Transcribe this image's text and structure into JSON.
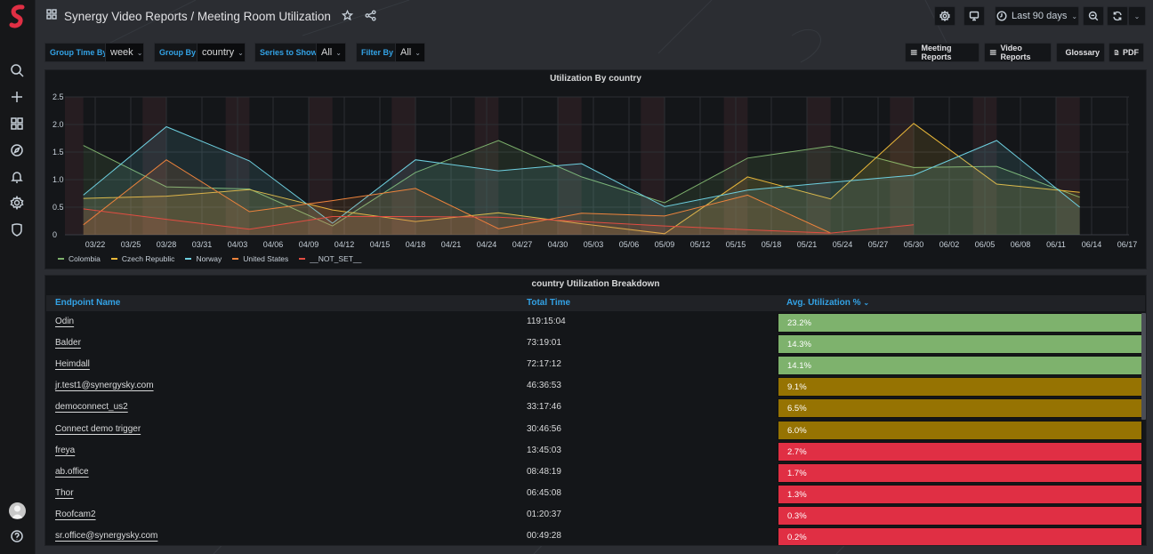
{
  "app": {
    "breadcrumb": "Synergy Video Reports / Meeting Room Utilization"
  },
  "header": {
    "time_range": "Last 90 days",
    "icons": [
      "settings-icon",
      "tv-mode-icon",
      "clock-icon",
      "zoom-out-icon",
      "refresh-icon",
      "chevron-down-icon"
    ]
  },
  "sidebar": {
    "items": [
      {
        "name": "search",
        "icon": "search-icon"
      },
      {
        "name": "create",
        "icon": "plus-icon"
      },
      {
        "name": "dashboards",
        "icon": "dashboards-icon"
      },
      {
        "name": "explore",
        "icon": "compass-icon"
      },
      {
        "name": "alerting",
        "icon": "bell-icon"
      },
      {
        "name": "configuration",
        "icon": "gear-icon"
      },
      {
        "name": "server-admin",
        "icon": "shield-icon"
      }
    ],
    "bottom": [
      {
        "name": "profile",
        "icon": "avatar"
      },
      {
        "name": "help",
        "icon": "help-icon"
      }
    ]
  },
  "variables": [
    {
      "label": "Group Time By",
      "value": "week"
    },
    {
      "label": "Group By",
      "value": "country"
    },
    {
      "label": "Series to Show",
      "value": "All"
    },
    {
      "label": "Filter By",
      "value": "All"
    }
  ],
  "links": [
    {
      "label": "Meeting Reports",
      "icon": "menu-icon"
    },
    {
      "label": "Video Reports",
      "icon": "menu-icon"
    },
    {
      "label": "Glossary",
      "icon": "info-icon"
    },
    {
      "label": "PDF",
      "icon": "document-icon"
    }
  ],
  "chart_data": {
    "type": "area",
    "title": "Utilization By country",
    "xlabel": "",
    "ylabel": "",
    "ylim": [
      0,
      2.5
    ],
    "yticks": [
      "0",
      "0.5",
      "1.0",
      "1.5",
      "2.0",
      "2.5"
    ],
    "xticks": [
      "03/22",
      "03/25",
      "03/28",
      "03/31",
      "04/03",
      "04/06",
      "04/09",
      "04/12",
      "04/15",
      "04/18",
      "04/21",
      "04/24",
      "04/27",
      "04/30",
      "05/03",
      "05/06",
      "05/09",
      "05/12",
      "05/15",
      "05/18",
      "05/21",
      "05/24",
      "05/27",
      "05/30",
      "06/02",
      "06/05",
      "06/08",
      "06/11",
      "06/14",
      "06/17"
    ],
    "x": [
      "03/21",
      "03/28",
      "04/04",
      "04/11",
      "04/18",
      "04/25",
      "05/02",
      "05/09",
      "05/16",
      "05/23",
      "05/30",
      "06/06",
      "06/13"
    ],
    "grid": true,
    "legend": "bottom-left",
    "series": [
      {
        "name": "Colombia",
        "color": "#7eb26d",
        "values": [
          1.62,
          0.87,
          0.83,
          0.16,
          1.13,
          1.71,
          1.05,
          0.58,
          1.39,
          1.61,
          1.22,
          1.24,
          0.68
        ]
      },
      {
        "name": "Czech Republic",
        "color": "#eab839",
        "values": [
          0.66,
          0.7,
          0.82,
          0.45,
          0.24,
          0.4,
          0.2,
          0.02,
          1.05,
          0.65,
          2.02,
          0.92,
          0.77
        ]
      },
      {
        "name": "Norway",
        "color": "#6ed0e0",
        "values": [
          0.72,
          1.96,
          1.34,
          0.21,
          1.36,
          1.16,
          1.29,
          0.51,
          0.81,
          0.95,
          1.08,
          1.71,
          0.5
        ]
      },
      {
        "name": "United States",
        "color": "#ef843c",
        "values": [
          0.18,
          1.36,
          0.42,
          0.62,
          0.84,
          0.11,
          0.39,
          0.34,
          0.72,
          0.03,
          null,
          null,
          null
        ]
      },
      {
        "name": "__NOT_SET__",
        "color": "#e24d42",
        "values": [
          0.47,
          0.28,
          0.1,
          0.33,
          0.33,
          0.32,
          0.24,
          0.16,
          0.09,
          0.03,
          0.18,
          null,
          null
        ]
      }
    ]
  },
  "table": {
    "title": "country Utilization Breakdown",
    "columns": [
      "Endpoint Name",
      "Total Time",
      "Avg. Utilization %"
    ],
    "sort_indicator": "chevron-down-icon",
    "thresholds_colors": {
      "high": "#7eb26d",
      "medium": "#967302",
      "low": "#e02f44"
    },
    "rows": [
      {
        "name": "Odin",
        "time": "119:15:04",
        "util": "23.2%",
        "level": "high"
      },
      {
        "name": "Balder",
        "time": "73:19:01",
        "util": "14.3%",
        "level": "high"
      },
      {
        "name": "Heimdall",
        "time": "72:17:12",
        "util": "14.1%",
        "level": "high"
      },
      {
        "name": "jr.test1@synergysky.com",
        "time": "46:36:53",
        "util": "9.1%",
        "level": "medium"
      },
      {
        "name": "democonnect_us2",
        "time": "33:17:46",
        "util": "6.5%",
        "level": "medium"
      },
      {
        "name": "Connect demo trigger",
        "time": "30:46:56",
        "util": "6.0%",
        "level": "medium"
      },
      {
        "name": "freya",
        "time": "13:45:03",
        "util": "2.7%",
        "level": "low"
      },
      {
        "name": "ab.office",
        "time": "08:48:19",
        "util": "1.7%",
        "level": "low"
      },
      {
        "name": "Thor",
        "time": "06:45:08",
        "util": "1.3%",
        "level": "low"
      },
      {
        "name": "Roofcam2",
        "time": "01:20:37",
        "util": "0.3%",
        "level": "low"
      },
      {
        "name": "sr.office@synergysky.com",
        "time": "00:49:28",
        "util": "0.2%",
        "level": "low"
      }
    ]
  }
}
